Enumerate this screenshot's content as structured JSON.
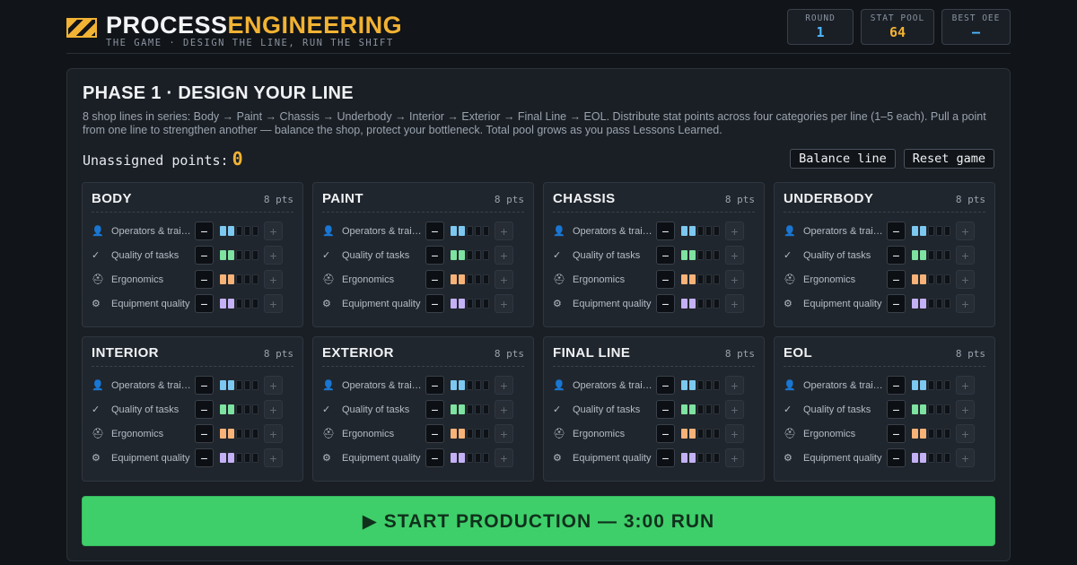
{
  "header": {
    "title_part1": "PROCESS",
    "title_part2": "ENGINEERING",
    "subtitle": "THE GAME · DESIGN THE LINE, RUN THE SHIFT",
    "stats": [
      {
        "label": "ROUND",
        "value": "1",
        "color": "#4fb8ff"
      },
      {
        "label": "STAT POOL",
        "value": "64",
        "color": "#f2b233"
      },
      {
        "label": "BEST OEE",
        "value": "–",
        "color": "#4fb8ff"
      }
    ]
  },
  "phase": {
    "title": "PHASE 1 · DESIGN YOUR LINE",
    "description": "8 shop lines in series: Body → Paint → Chassis → Underbody → Interior → Exterior → Final Line → EOL. Distribute stat points across four categories per line (1–5 each). Pull a point from one line to strengthen another — balance the shop, protect your bottleneck. Total pool grows as you pass Lessons Learned.",
    "unassigned_label": "Unassigned points:",
    "unassigned_value": "0",
    "balance_label": "Balance line",
    "reset_label": "Reset game",
    "start_label": "▶ START PRODUCTION — 3:00 RUN"
  },
  "categories": [
    {
      "icon": "👤",
      "icon_name": "operator-icon",
      "label": "Operators & training",
      "color": "#7cc8f0"
    },
    {
      "icon": "✓",
      "icon_name": "check-icon",
      "label": "Quality of tasks",
      "color": "#7ee2a0"
    },
    {
      "icon": "⛑",
      "icon_name": "helmet-icon",
      "label": "Ergonomics",
      "color": "#f7b278"
    },
    {
      "icon": "⚙",
      "icon_name": "gear-icon",
      "label": "Equipment quality",
      "color": "#c4b0f5"
    }
  ],
  "lines": [
    {
      "name": "BODY",
      "pts": "8 pts",
      "levels": [
        2,
        2,
        2,
        2
      ]
    },
    {
      "name": "PAINT",
      "pts": "8 pts",
      "levels": [
        2,
        2,
        2,
        2
      ]
    },
    {
      "name": "CHASSIS",
      "pts": "8 pts",
      "levels": [
        2,
        2,
        2,
        2
      ]
    },
    {
      "name": "UNDERBODY",
      "pts": "8 pts",
      "levels": [
        2,
        2,
        2,
        2
      ]
    },
    {
      "name": "INTERIOR",
      "pts": "8 pts",
      "levels": [
        2,
        2,
        2,
        2
      ]
    },
    {
      "name": "EXTERIOR",
      "pts": "8 pts",
      "levels": [
        2,
        2,
        2,
        2
      ]
    },
    {
      "name": "FINAL LINE",
      "pts": "8 pts",
      "levels": [
        2,
        2,
        2,
        2
      ]
    },
    {
      "name": "EOL",
      "pts": "8 pts",
      "levels": [
        2,
        2,
        2,
        2
      ]
    }
  ],
  "max_level": 5,
  "controls": {
    "minus": "−",
    "plus": "+"
  }
}
